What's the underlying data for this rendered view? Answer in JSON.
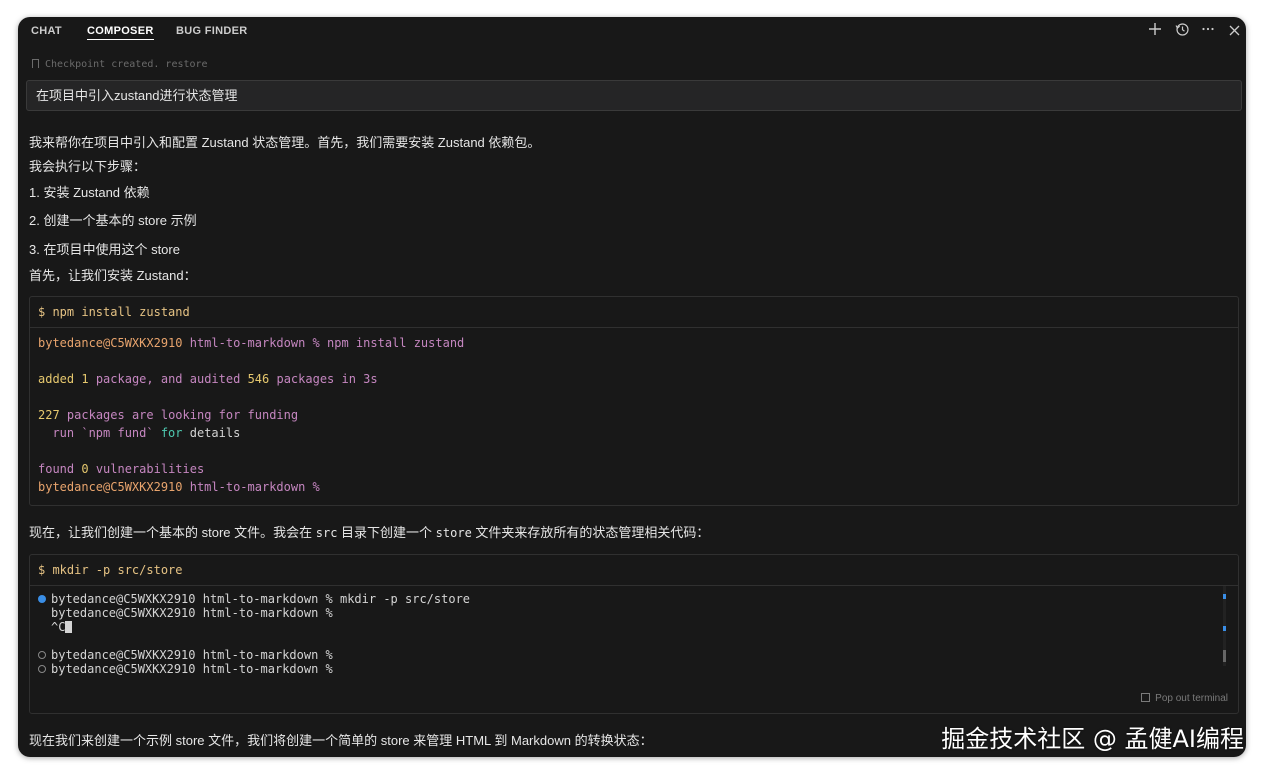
{
  "tabs": [
    "CHAT",
    "COMPOSER",
    "BUG FINDER"
  ],
  "toolbar_icons": [
    "plus-icon",
    "history-icon",
    "more-icon",
    "close-icon"
  ],
  "checkpoint": {
    "text": "Checkpoint created.",
    "restore": "restore"
  },
  "prompt": "在项目中引入zustand进行状态管理",
  "intro": [
    "我来帮你在项目中引入和配置 Zustand 状态管理。首先，我们需要安装 Zustand 依赖包。",
    "我会执行以下步骤：",
    "1. 安装 Zustand 依赖",
    "2. 创建一个基本的 store 示例",
    "3. 在项目中使用这个 store",
    "首先，让我们安装 Zustand："
  ],
  "terminal1": {
    "command": "$ npm install zustand",
    "prompt_user": "bytedance@C5WXKX2910",
    "prompt_dir": "html-to-markdown %",
    "cmd": "npm install zustand",
    "added_a": "added",
    "added_n1": "1",
    "added_b": "package, and audited",
    "added_n2": "546",
    "added_c": "packages in 3s",
    "funding_n": "227",
    "funding_text": "packages are looking for funding",
    "run_text": "  run `npm fund`",
    "for_text": "for",
    "details_text": "details",
    "found_a": "found",
    "found_n": "0",
    "found_b": "vulnerabilities"
  },
  "middle_text": {
    "a": "现在，让我们创建一个基本的 store 文件。我会在 ",
    "code1": "src",
    "b": " 目录下创建一个 ",
    "code2": "store",
    "c": " 文件夹来存放所有的状态管理相关代码："
  },
  "terminal2": {
    "command": "$ mkdir -p src/store",
    "lines": [
      "bytedance@C5WXKX2910 html-to-markdown % mkdir -p src/store",
      "bytedance@C5WXKX2910 html-to-markdown %",
      "^C",
      "bytedance@C5WXKX2910 html-to-markdown %",
      "bytedance@C5WXKX2910 html-to-markdown %"
    ],
    "popout": "Pop out terminal"
  },
  "bottom_text": "现在我们来创建一个示例 store 文件，我们将创建一个简单的 store 来管理 HTML 到 Markdown 的转换状态：",
  "watermark": "掘金技术社区 @ 孟健AI编程"
}
